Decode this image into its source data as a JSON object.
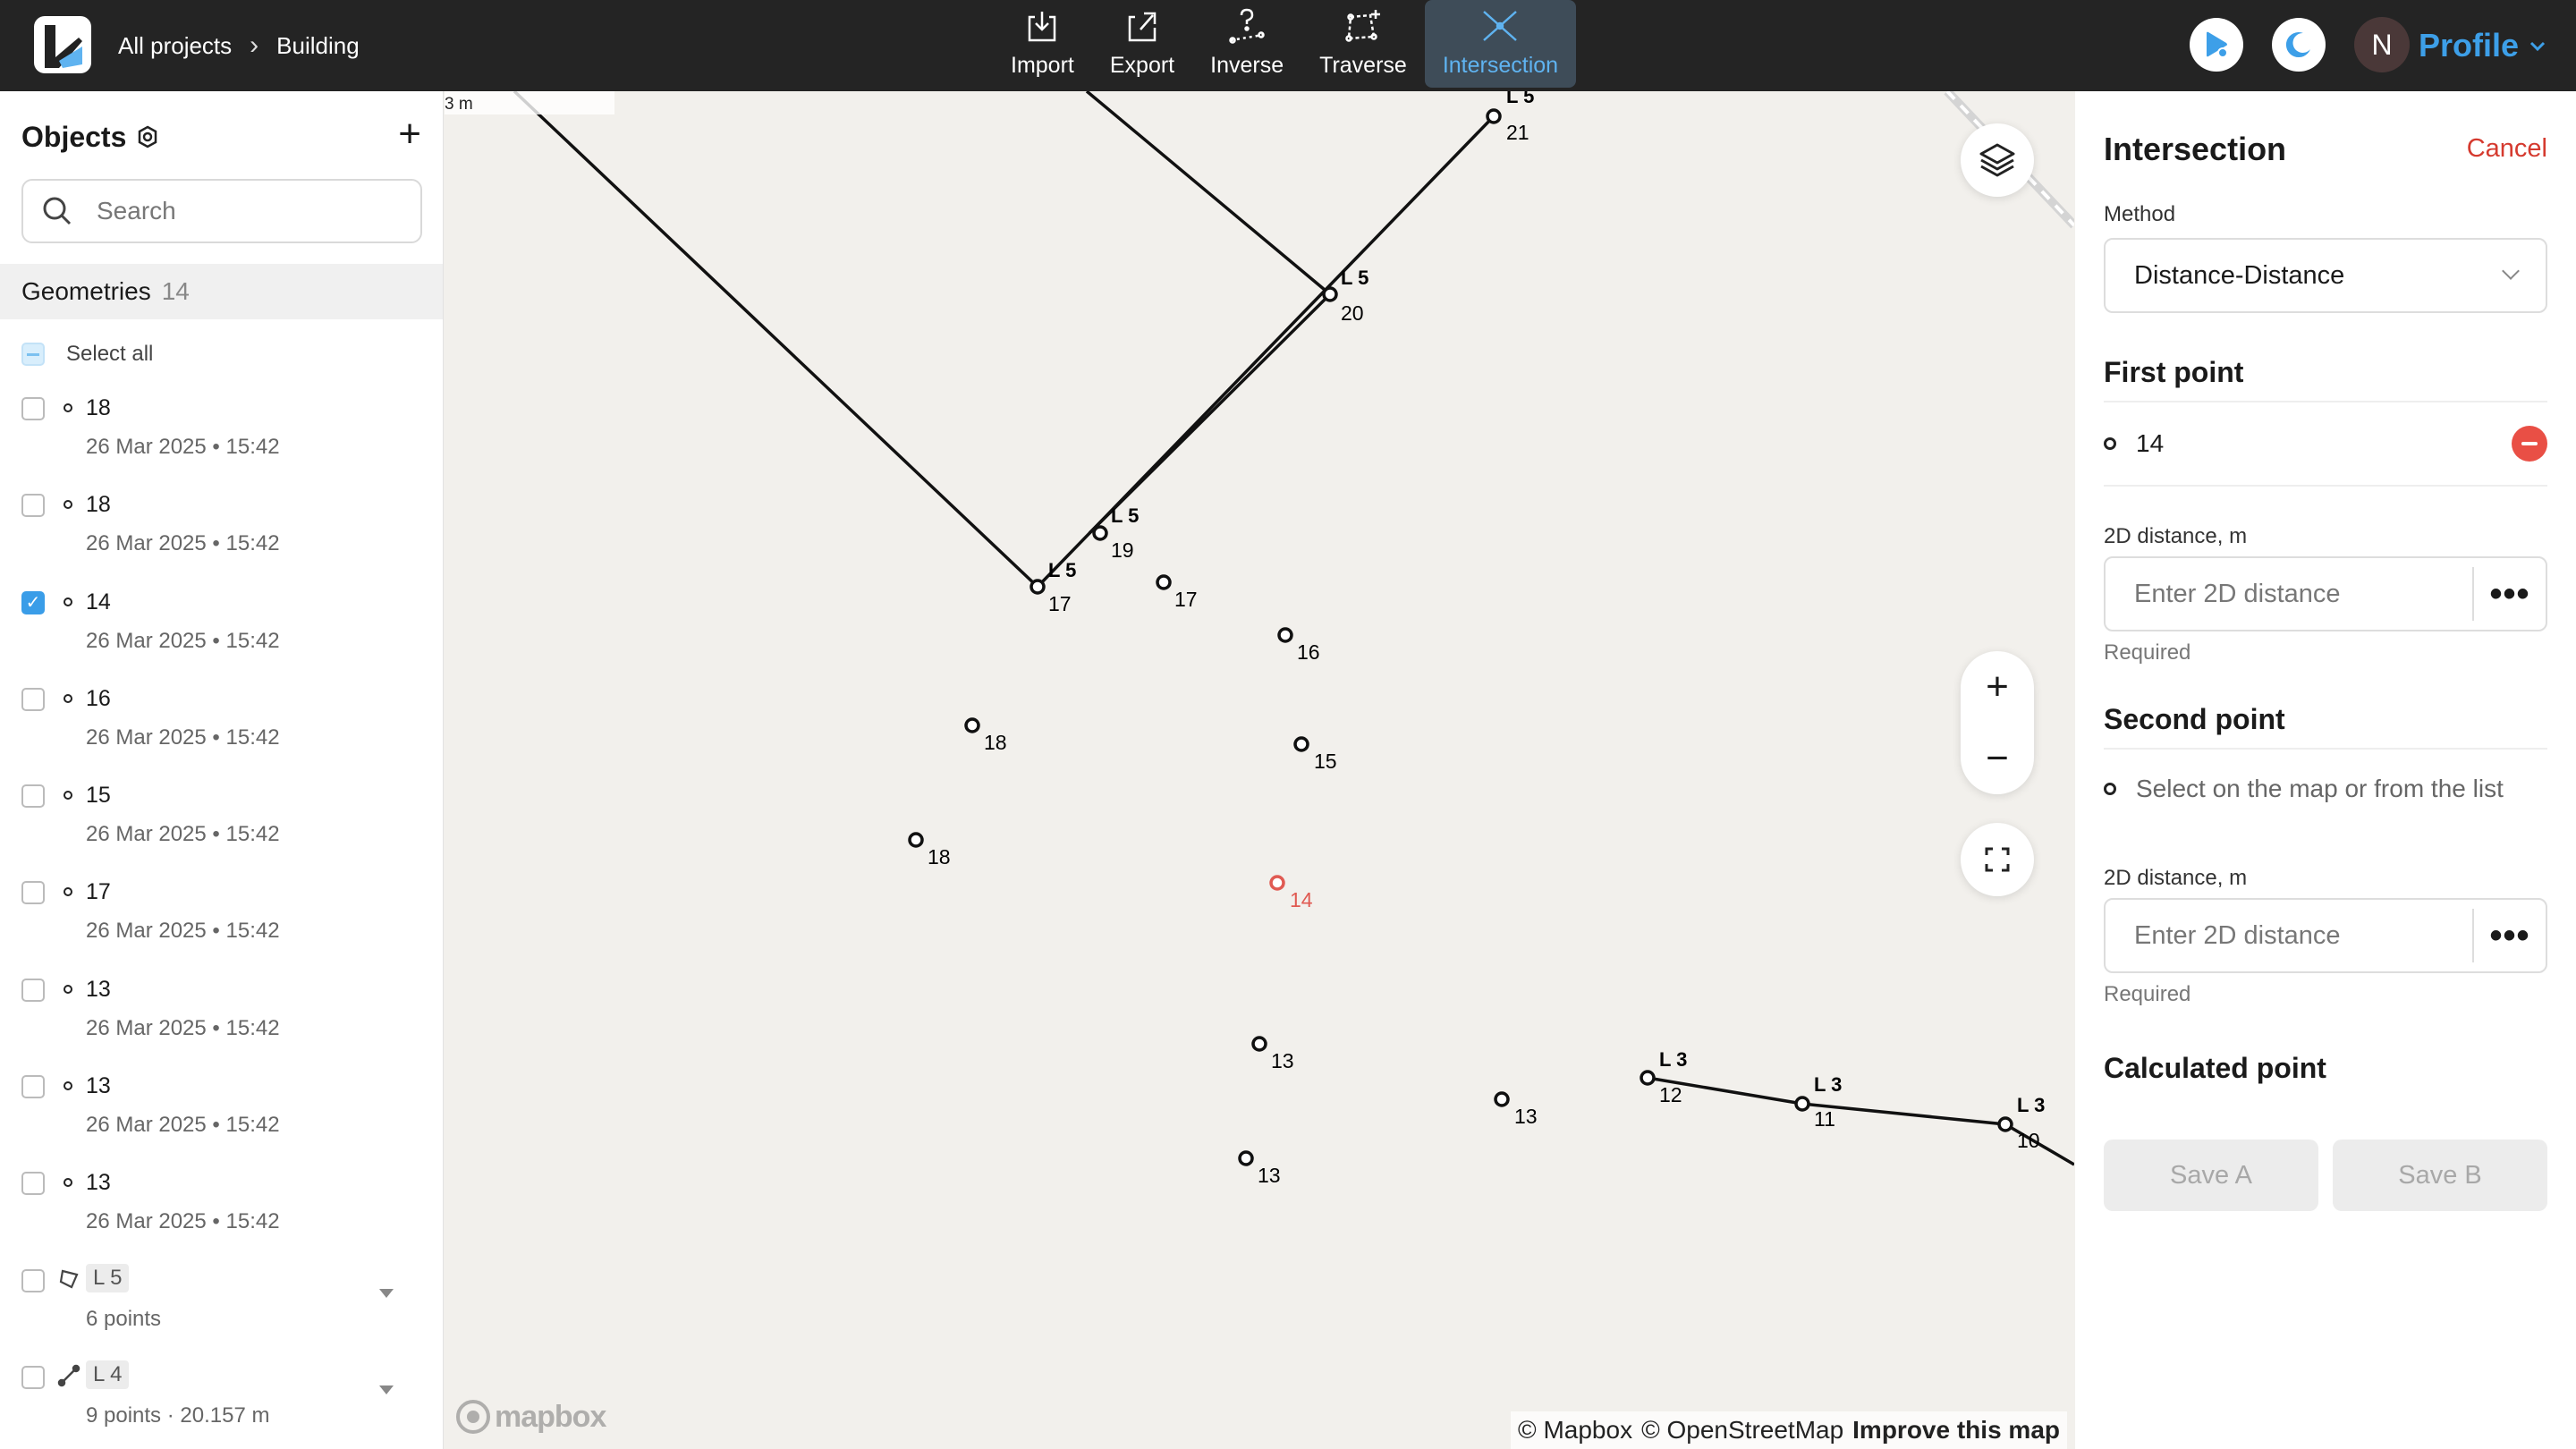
{
  "header": {
    "breadcrumb": [
      "All projects",
      "Building"
    ],
    "tools": [
      {
        "label": "Import",
        "icon": "import-icon"
      },
      {
        "label": "Export",
        "icon": "export-icon"
      },
      {
        "label": "Inverse",
        "icon": "inverse-icon"
      },
      {
        "label": "Traverse",
        "icon": "traverse-icon"
      },
      {
        "label": "Intersection",
        "icon": "intersection-icon",
        "active": true
      }
    ],
    "avatar_initial": "N",
    "profile_label": "Profile",
    "accent": "#3d9fe8"
  },
  "sidebar": {
    "title": "Objects",
    "search_placeholder": "Search",
    "geometries_label": "Geometries",
    "geometries_count": "14",
    "select_all_label": "Select all",
    "items": [
      {
        "name": "18",
        "date": "26 Mar 2025 • 15:42",
        "checked": false
      },
      {
        "name": "18",
        "date": "26 Mar 2025 • 15:42",
        "checked": false
      },
      {
        "name": "14",
        "date": "26 Mar 2025 • 15:42",
        "checked": true
      },
      {
        "name": "16",
        "date": "26 Mar 2025 • 15:42",
        "checked": false
      },
      {
        "name": "15",
        "date": "26 Mar 2025 • 15:42",
        "checked": false
      },
      {
        "name": "17",
        "date": "26 Mar 2025 • 15:42",
        "checked": false
      },
      {
        "name": "13",
        "date": "26 Mar 2025 • 15:42",
        "checked": false
      },
      {
        "name": "13",
        "date": "26 Mar 2025 • 15:42",
        "checked": false
      },
      {
        "name": "13",
        "date": "26 Mar 2025 • 15:42",
        "checked": false
      }
    ],
    "lines": [
      {
        "tag": "L 5",
        "info": "6 points",
        "icon": "polygon-icon"
      },
      {
        "tag": "L 4",
        "info": "9 points · 20.157 m",
        "icon": "polyline-icon"
      }
    ]
  },
  "map": {
    "scale_label": "3 m",
    "attribution": [
      "© Mapbox",
      "© OpenStreetMap",
      "Improve this map"
    ],
    "logo_text": "mapbox",
    "highlight_color": "#e05a52",
    "points": [
      {
        "id": "21",
        "line": "L 5"
      },
      {
        "id": "20",
        "line": "L 5"
      },
      {
        "id": "19",
        "line": "L 5"
      },
      {
        "id": "17",
        "line": "L 5"
      },
      {
        "id": "17",
        "line": ""
      },
      {
        "id": "16",
        "line": ""
      },
      {
        "id": "18",
        "line": ""
      },
      {
        "id": "15",
        "line": ""
      },
      {
        "id": "18",
        "line": ""
      },
      {
        "id": "14",
        "line": "",
        "highlight": true
      },
      {
        "id": "13",
        "line": ""
      },
      {
        "id": "13",
        "line": ""
      },
      {
        "id": "13",
        "line": ""
      },
      {
        "id": "12",
        "line": "L 3"
      },
      {
        "id": "11",
        "line": "L 3"
      },
      {
        "id": "10",
        "line": "L 3"
      }
    ]
  },
  "panel": {
    "title": "Intersection",
    "cancel_label": "Cancel",
    "method_label": "Method",
    "method_value": "Distance-Distance",
    "first_point_title": "First point",
    "first_point_value": "14",
    "distance_label": "2D distance, m",
    "distance_placeholder": "Enter 2D distance",
    "required_label": "Required",
    "second_point_title": "Second point",
    "second_point_hint": "Select on the map or from the list",
    "calculated_title": "Calculated point",
    "save_a_label": "Save A",
    "save_b_label": "Save B",
    "cancel_color": "#d53a2f"
  }
}
